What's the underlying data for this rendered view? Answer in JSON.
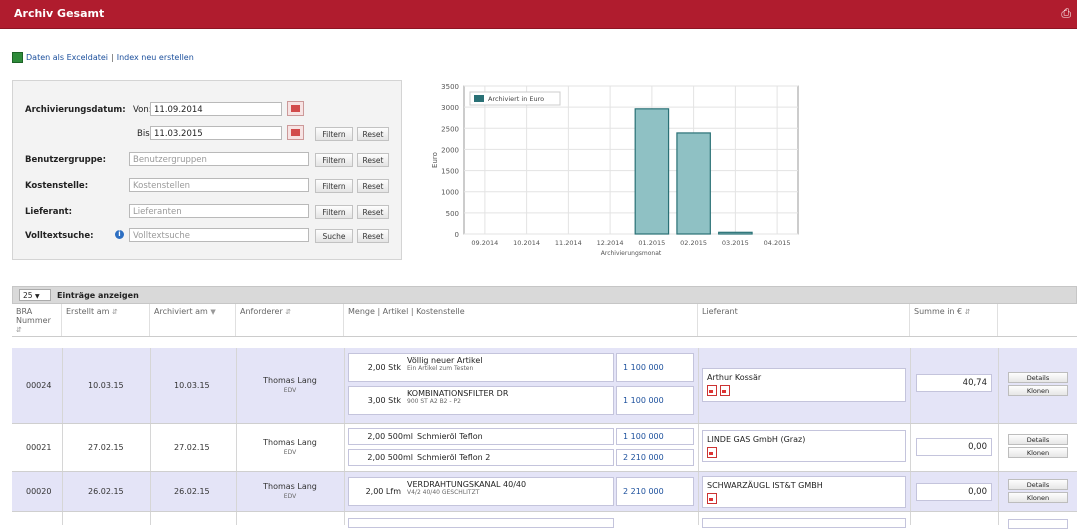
{
  "title": "Archiv Gesamt",
  "title_icon": "print-icon",
  "toolbar": {
    "excel_link": "Daten als Exceldatei",
    "separator": "|",
    "index_link": "Index neu erstellen"
  },
  "filters": {
    "archivierungsdatum_label": "Archivierungsdatum:",
    "von_label": "Von:",
    "von_value": "11.09.2014",
    "bis_label": "Bis:",
    "bis_value": "11.03.2015",
    "benutzergruppe_label": "Benutzergruppe:",
    "benutzergruppe_placeholder": "Benutzergruppen",
    "kostenstelle_label": "Kostenstelle:",
    "kostenstelle_placeholder": "Kostenstellen",
    "lieferant_label": "Lieferant:",
    "lieferant_placeholder": "Lieferanten",
    "volltext_label": "Volltextsuche:",
    "volltext_placeholder": "Volltextsuche",
    "filter_btn": "Filtern",
    "reset_btn": "Reset",
    "suche_btn": "Suche"
  },
  "chart_data": {
    "type": "bar",
    "categories": [
      "09.2014",
      "10.2014",
      "11.2014",
      "12.2014",
      "01.2015",
      "02.2015",
      "03.2015",
      "04.2015"
    ],
    "series": [
      {
        "name": "Archiviert in Euro",
        "values": [
          0,
          0,
          0,
          0,
          2960,
          2390,
          40,
          0
        ]
      }
    ],
    "xlabel": "Archivierungsmonat",
    "ylabel": "Euro",
    "ylim": [
      0,
      3500
    ],
    "yticks": [
      0,
      500,
      1000,
      1500,
      2000,
      2500,
      3000,
      3500
    ],
    "bar_color": "#8fc1c4",
    "bar_edge": "#2a7176",
    "legend_position": "top-left",
    "grid": true
  },
  "table": {
    "length_value": "25",
    "length_label": "Einträge anzeigen",
    "columns": [
      "BRA Nummer",
      "Erstellt am",
      "Archiviert am",
      "Anforderer",
      "Menge | Artikel | Kostenstelle",
      "Lieferant",
      "Summe in €"
    ],
    "rows": [
      {
        "nr": "00024",
        "erstellt": "10.03.15",
        "archiviert": "10.03.15",
        "name": "Thomas Lang",
        "abt": "EDV",
        "items": [
          {
            "qty": "2,00 Stk",
            "title": "Völlig neuer Artikel",
            "sub": "Ein Artikel zum Testen",
            "ks": "1 100 000"
          },
          {
            "qty": "3,00 Stk",
            "title": "KOMBINATIONSFILTER DR",
            "sub": "900 ST A2 B2 - P2",
            "ks": "1 100 000"
          }
        ],
        "lieferant": "Arthur Kossär",
        "summe": "40,74",
        "details": "Details",
        "klonen": "Klonen"
      },
      {
        "nr": "00021",
        "erstellt": "27.02.15",
        "archiviert": "27.02.15",
        "name": "Thomas Lang",
        "abt": "EDV",
        "items": [
          {
            "qty": "2,00 500ml",
            "title": "Schmieröl Teflon",
            "ks": "1 100 000"
          },
          {
            "qty": "2,00 500ml",
            "title": "Schmieröl Teflon 2",
            "ks": "2 210 000"
          }
        ],
        "lieferant": "LINDE GAS GmbH (Graz)",
        "summe": "0,00",
        "details": "Details",
        "klonen": "Klonen"
      },
      {
        "nr": "00020",
        "erstellt": "26.02.15",
        "archiviert": "26.02.15",
        "name": "Thomas Lang",
        "abt": "EDV",
        "items": [
          {
            "qty": "2,00 Lfm",
            "title": "VERDRAHTUNGSKANAL 40/40",
            "sub": "V4/2 40/40 GESCHLITZT",
            "ks": "2 210 000"
          }
        ],
        "lieferant": "SCHWARZÄUGL IST&T GMBH",
        "summe": "0,00",
        "details": "Details",
        "klonen": "Klonen"
      }
    ]
  }
}
